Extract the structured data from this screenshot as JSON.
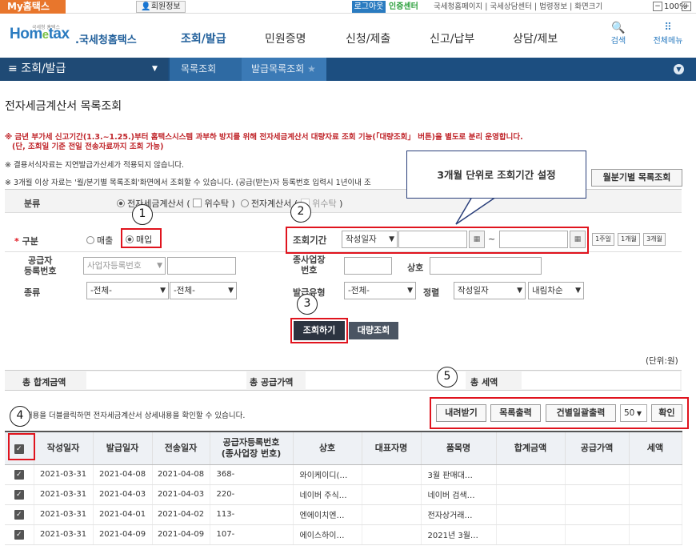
{
  "top": {
    "my_home": "My홈택스",
    "member_info": "회원정보",
    "logout": "로그아웃",
    "auth_center": "인증센터",
    "util_links": "국세청홈페이지 | 국세상담센터 | 법령정보 | 화면크기",
    "zoom_minus": "−",
    "zoom": "100%",
    "zoom_plus": "+"
  },
  "header": {
    "logo_small": "국세청 홈택스",
    "logo_main": "Hom",
    "logo_e": "e",
    "logo_tail": "tax",
    "logo_sub": ".국세청홈택스",
    "menu": [
      "조회/발급",
      "민원증명",
      "신청/제출",
      "신고/납부",
      "상담/제보"
    ],
    "search": "검색",
    "all_menu": "전체메뉴"
  },
  "nav": {
    "section": "조회/발급",
    "crumbs": [
      "목록조회",
      "발급목록조회"
    ]
  },
  "page": {
    "title": "전자세금계산서 목록조회",
    "notice1_line1": "※ 금년 부가세 신고기간(1.3.~1.25.)부터 홈택스시스템 과부하 방지를 위해 전자세금계산서 대량자료 조회 기능(「대량조회」 버튼)을 별도로 분리 운영합니다.",
    "notice1_line2": "(단, 조회일 기준 전일 전송자료까지 조회 가능)",
    "notice2": "※ 결용서식자료는 지연발급가산세가 적용되지 않습니다.",
    "notice3": "※ 3개월 이상 자료는 '월/분기별 목록조회'화면에서 조회할 수 있습니다. (공급(받는)자 등록번호 입력시 1년이내 조",
    "monthly_btn": "월분기별 목록조회",
    "callout": "3개월 단위로 조회기간 설정"
  },
  "form": {
    "category_label": "분류",
    "category_opt1": "전자세금계산서 (",
    "consign1": "위수탁",
    "paren_close": ")",
    "category_opt2": "전자계산서 (",
    "consign2": "위수탁",
    "div_required": "*",
    "div_label": "구분",
    "div_sale": "매출",
    "div_buy": "매입",
    "period_label": "조회기간",
    "period_type": "작성일자",
    "tilde": "~",
    "quick": [
      "1주일",
      "1개월",
      "3개월"
    ],
    "supplier_label1": "공급자",
    "supplier_label2": "등록번호",
    "supplier_type": "사업자등록번호",
    "branch_label1": "종사업장",
    "branch_label2": "번호",
    "company_label": "상호",
    "kind_label": "종류",
    "kind_value1": "-전체-",
    "kind_value2": "-전체-",
    "issue_label": "발급유형",
    "issue_value": "-전체-",
    "sort_label": "정렬",
    "sort_value1": "작성일자",
    "sort_value2": "내림차순",
    "query_btn": "조회하기",
    "bulk_btn": "대량조회"
  },
  "summary": {
    "unit": "(단위:원)",
    "total_amount": "총 합계금액",
    "supply_amount": "총 공급가액",
    "tax_amount": "총 세액"
  },
  "actions": {
    "hint": "된 내용을 더블클릭하면 전자세금계산서 상세내용을 확인할 수 있습니다.",
    "download": "내려받기",
    "print_list": "목록출력",
    "print_each": "건별일괄출력",
    "page_size": "50",
    "confirm": "확인"
  },
  "table": {
    "headers": [
      "작성일자",
      "발급일자",
      "전송일자",
      "공급자등록번호",
      "(종사업장 번호)",
      "상호",
      "대표자명",
      "품목명",
      "합계금액",
      "공급가액",
      "세액"
    ],
    "rows": [
      {
        "written": "2021-03-31",
        "issued": "2021-04-08",
        "sent": "2021-04-08",
        "reg": "368-",
        "company": "와이케이디(…",
        "rep": "",
        "item": "3월 판매대…",
        "total": "",
        "supply": "",
        "tax": ""
      },
      {
        "written": "2021-03-31",
        "issued": "2021-04-03",
        "sent": "2021-04-03",
        "reg": "220-",
        "company": "네이버 주식…",
        "rep": "",
        "item": "네이버 검색…",
        "total": "",
        "supply": "",
        "tax": ""
      },
      {
        "written": "2021-03-31",
        "issued": "2021-04-01",
        "sent": "2021-04-02",
        "reg": "113-",
        "company": "엔에이치엔…",
        "rep": "",
        "item": "전자상거래…",
        "total": "",
        "supply": "",
        "tax": ""
      },
      {
        "written": "2021-03-31",
        "issued": "2021-04-09",
        "sent": "2021-04-09",
        "reg": "107-",
        "company": "에이스하이…",
        "rep": "",
        "item": "2021년 3월…",
        "total": "",
        "supply": "",
        "tax": ""
      }
    ]
  },
  "annotations": [
    "1",
    "2",
    "3",
    "4",
    "5"
  ]
}
